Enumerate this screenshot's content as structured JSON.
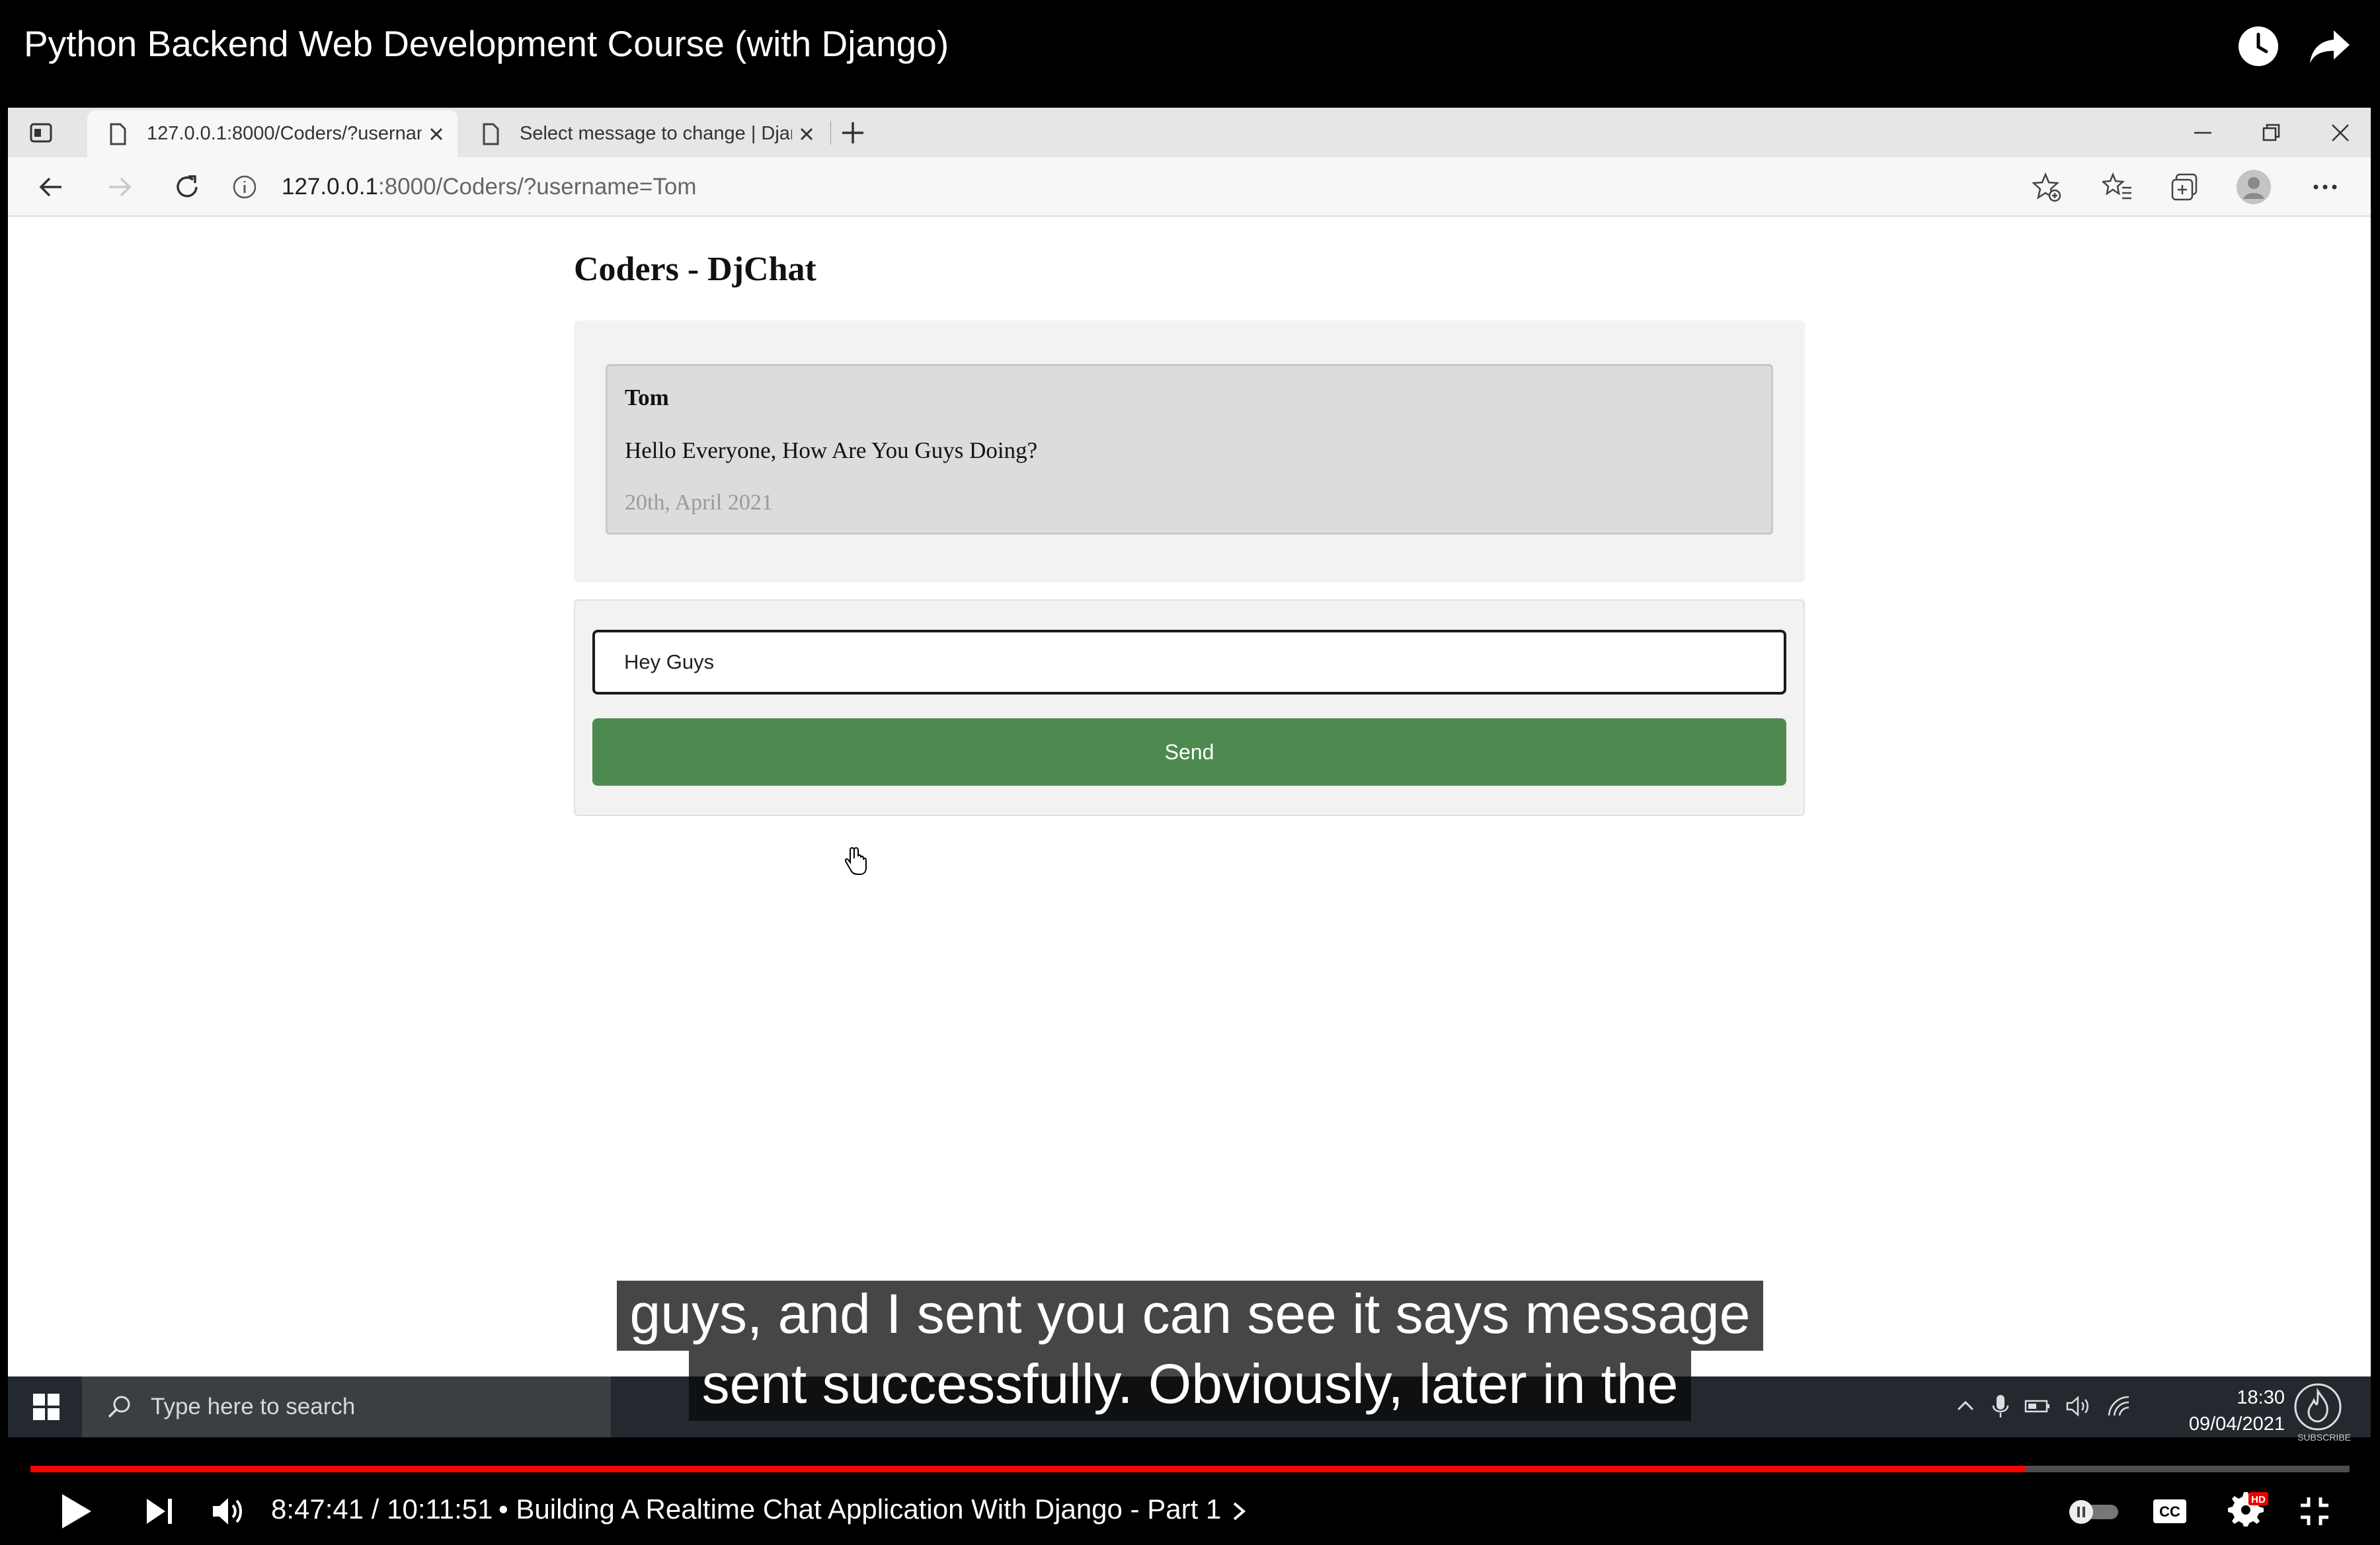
{
  "youtube": {
    "video_title": "Python Backend Web Development Course (with Django)",
    "current_time": "8:47:41",
    "duration": "10:11:51",
    "time_separator": " / ",
    "chapter": "• Building A Realtime Chat Application With Django - Part 1",
    "progress_fraction": 0.86,
    "hd_badge": "HD",
    "cc_label": "CC"
  },
  "browser": {
    "tabs": [
      {
        "label": "127.0.0.1:8000/Coders/?usernam",
        "active": true
      },
      {
        "label": "Select message to change | Djan",
        "active": false
      }
    ],
    "url_host": "127.0.0.1",
    "url_path": ":8000/Coders/?username=Tom"
  },
  "page": {
    "title": "Coders - DjChat",
    "messages": [
      {
        "user": "Tom",
        "text": "Hello Everyone, How Are You Guys Doing?",
        "date": "20th, April 2021"
      }
    ],
    "input_value": "Hey Guys",
    "send_label": "Send"
  },
  "captions": {
    "line1": "guys, and I sent you can see it says message",
    "line2": "sent successfully. Obviously, later in the"
  },
  "taskbar": {
    "search_placeholder": "Type here to search",
    "time": "18:30",
    "date": "09/04/2021",
    "subscribe_label": "SUBSCRIBE"
  },
  "colors": {
    "send_button": "#4e8a4f",
    "progress": "#ff0000"
  }
}
